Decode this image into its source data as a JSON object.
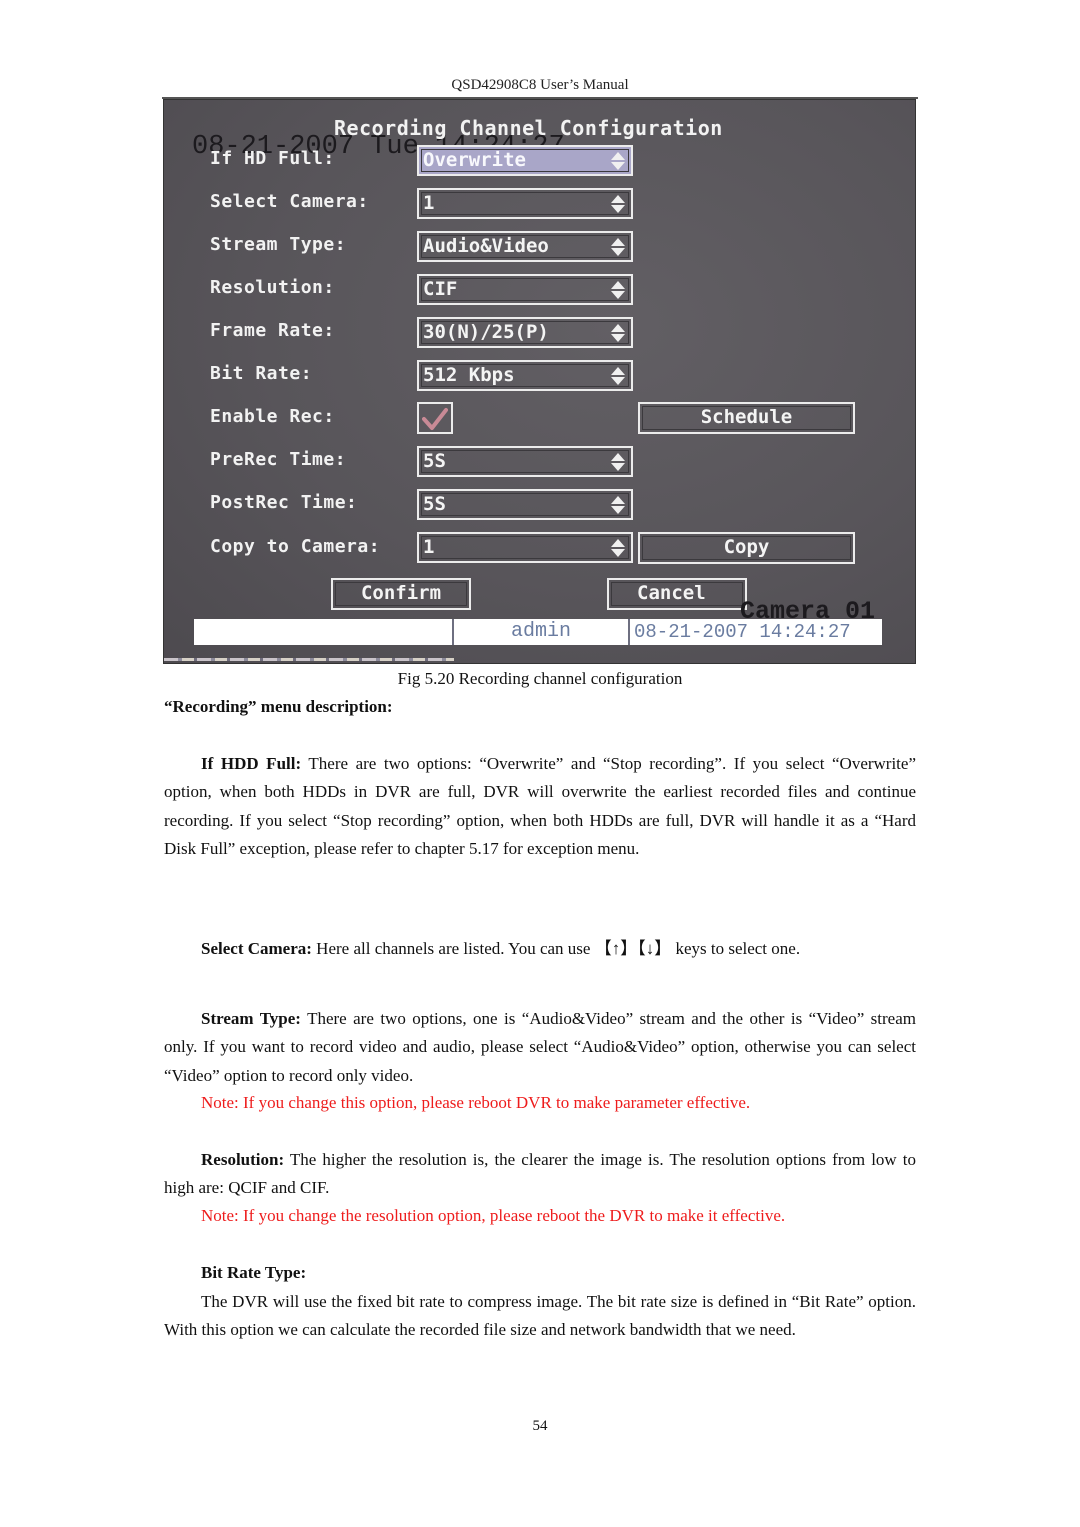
{
  "document": {
    "running_header": "QSD42908C8 User’s Manual",
    "page_number": "54"
  },
  "dvr_screen": {
    "title": "Recording Channel Configuration",
    "overlay_datetime": "08-21-2007 Tue 14:24:27",
    "fields": [
      {
        "label": "If HD Full:",
        "value": "Overwrite",
        "selected": true
      },
      {
        "label": "Select Camera:",
        "value": "1"
      },
      {
        "label": "Stream Type:",
        "value": "Audio&Video"
      },
      {
        "label": "Resolution:",
        "value": "CIF"
      },
      {
        "label": "Frame Rate:",
        "value": "30(N)/25(P)"
      },
      {
        "label": "Bit Rate:",
        "value": "512 Kbps"
      },
      {
        "label": "Enable Rec:",
        "checked": true
      },
      {
        "label": "PreRec Time:",
        "value": "5S"
      },
      {
        "label": "PostRec Time:",
        "value": "5S"
      },
      {
        "label": "Copy to Camera:",
        "value": "1"
      }
    ],
    "buttons": {
      "schedule": "Schedule",
      "copy": "Copy",
      "confirm": "Confirm",
      "cancel": "Cancel"
    },
    "status_bar": {
      "left": "",
      "user": "admin",
      "datetime": "08-21-2007 14:24:27"
    },
    "camera_label": "Camera 01",
    "colors": {
      "background": "#58555a",
      "selected_field": "#a9a6c8",
      "checkmark": "#c98a96",
      "status_text": "#6a7ca0"
    }
  },
  "caption": "Fig 5.20 Recording channel configuration",
  "section_title": "“Recording” menu description:",
  "sections": {
    "hdd_full": {
      "term": "If HDD Full:",
      "text": " There are two options: “Overwrite” and “Stop recording”. If you select “Overwrite” option, when both HDDs in DVR are full, DVR will overwrite the earliest recorded files and continue recording. If you select “Stop recording” option, when both HDDs are full, DVR will handle it as a “Hard Disk Full” exception, please refer to chapter 5.17 for exception menu."
    },
    "select_camera": {
      "term": "Select Camera:",
      "text": " Here all channels are listed. You can use 【↑】【↓】 keys to select one."
    },
    "stream_type": {
      "term": "Stream Type:",
      "text": " There are two options, one is “Audio&Video” stream and the other is “Video” stream only. If you want to record video and audio, please select “Audio&Video” option, otherwise you can select “Video” option to record only video.",
      "note": "Note: If you change this option, please reboot DVR to make parameter effective."
    },
    "resolution": {
      "term": "Resolution:",
      "text": " The higher the resolution is, the clearer the image is. The resolution options from low to high are: QCIF and CIF.",
      "note": "Note: If you change the resolution option, please reboot the DVR to make it effective."
    },
    "bit_rate_type": {
      "heading": "Bit Rate Type:",
      "text": "The DVR will use the fixed bit rate to compress image. The bit rate size is defined in “Bit Rate” option. With this option we can calculate the recorded file size and network bandwidth that we need."
    }
  }
}
